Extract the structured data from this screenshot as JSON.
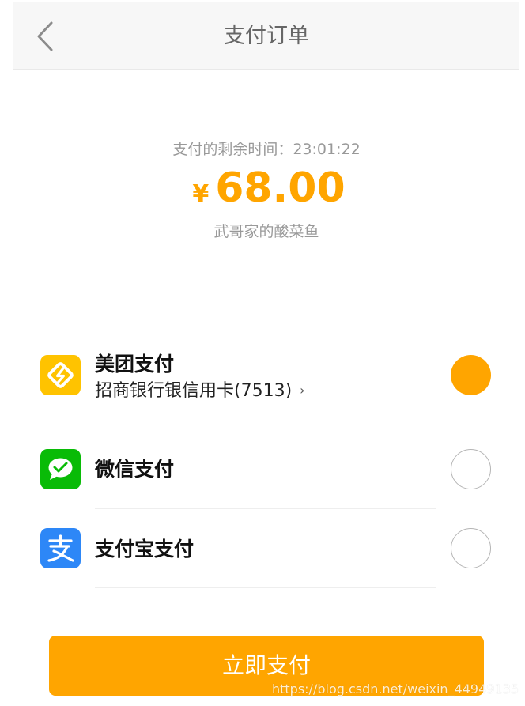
{
  "header": {
    "title": "支付订单",
    "back_icon": "chevron-left-icon"
  },
  "order": {
    "countdown_label": "支付的剩余时间：",
    "countdown_value": "23:01:22",
    "currency_symbol": "¥",
    "amount": "68.00",
    "merchant": "武哥家的酸菜鱼"
  },
  "payment_methods": [
    {
      "name": "美团支付",
      "sub_label": "招商银行银信用卡(7513)",
      "sub_arrow": "›",
      "icon": "meituan-pay-icon",
      "icon_color": "#ffc300",
      "selected": true
    },
    {
      "name": "微信支付",
      "icon": "wechat-pay-icon",
      "icon_color": "#09bb07",
      "selected": false
    },
    {
      "name": "支付宝支付",
      "icon": "alipay-icon",
      "icon_color": "#1677ff",
      "selected": false
    }
  ],
  "pay_button": {
    "label": "立即支付"
  },
  "watermark": "https://blog.csdn.net/weixin_44949135",
  "colors": {
    "accent": "#ffa500",
    "header_bg": "#f7f7f7",
    "muted_text": "#999999"
  }
}
